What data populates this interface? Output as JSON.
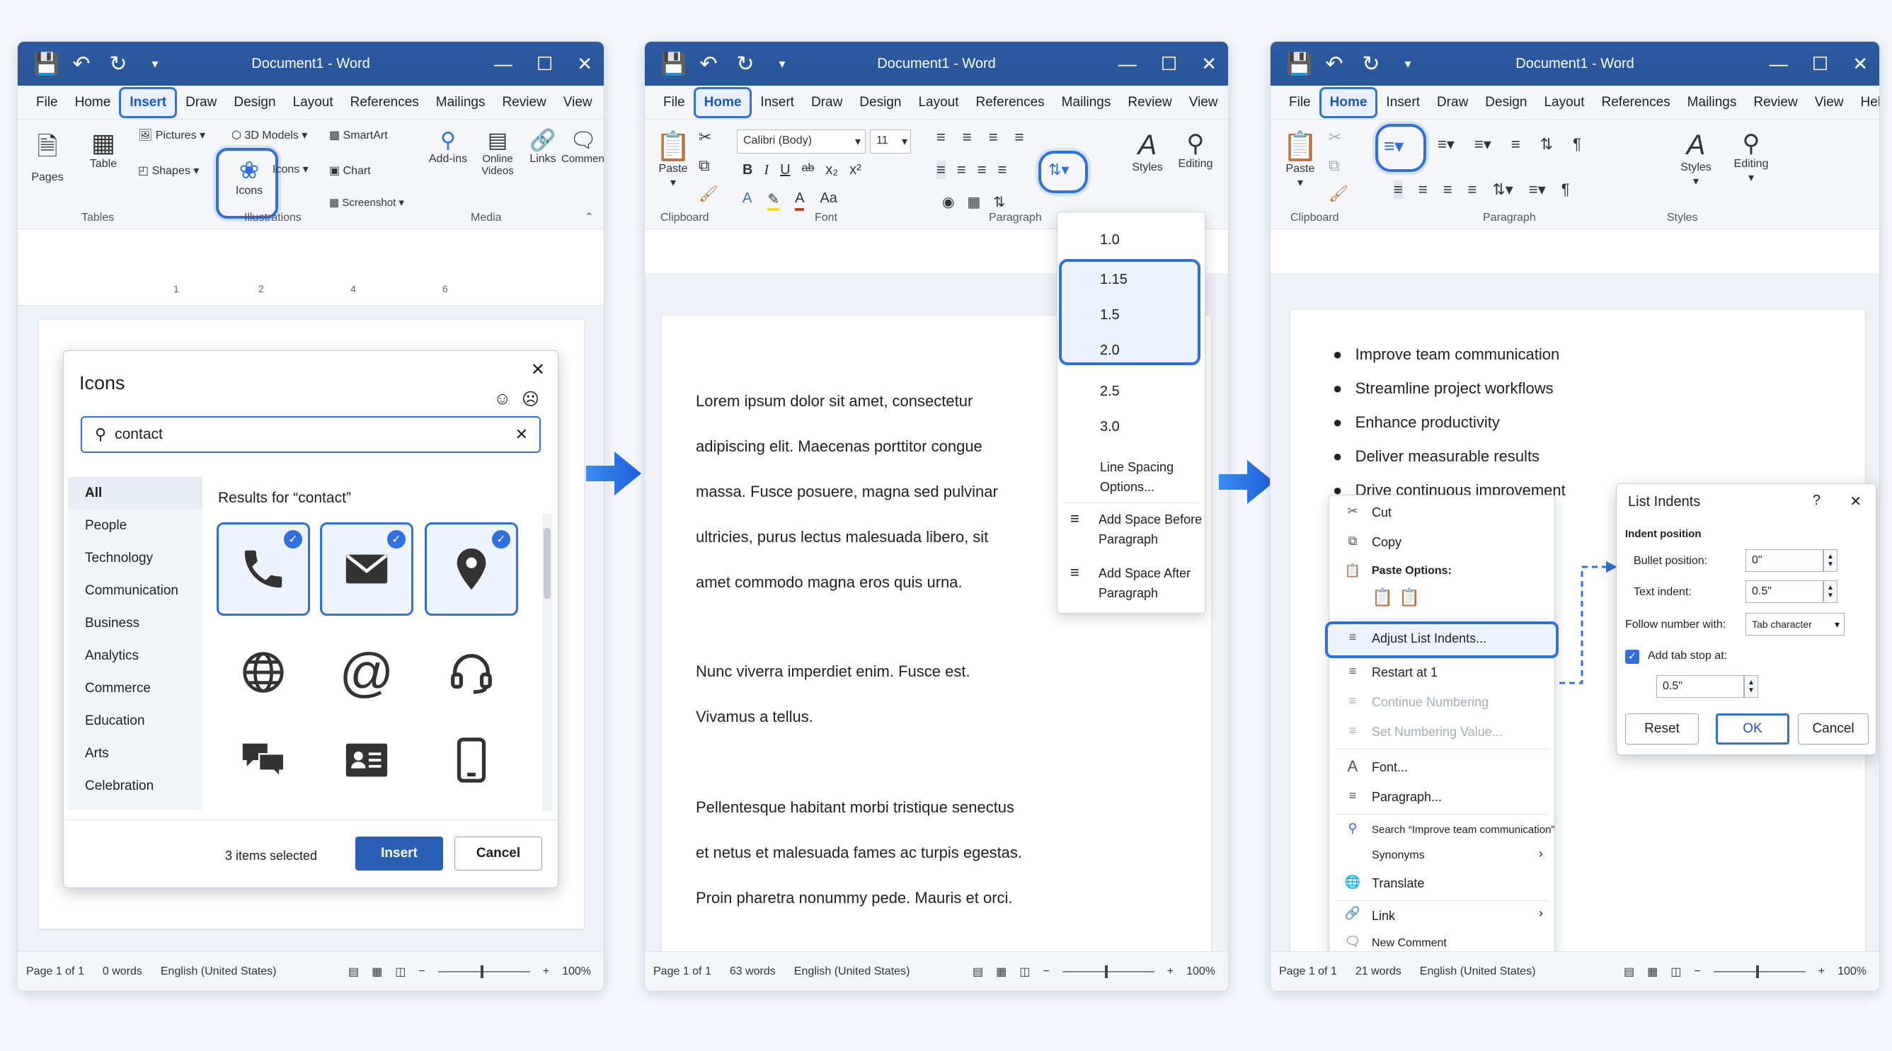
{
  "common": {
    "window_title": "Document1 - Word",
    "menu": [
      "File",
      "Home",
      "Insert",
      "Draw",
      "Design",
      "Layout",
      "References",
      "Mailings",
      "Review",
      "View",
      "Help"
    ],
    "status_language": "English (United States)",
    "status_page": "Page 1 of 1",
    "zoom": "100%"
  },
  "win1": {
    "active_tab": "Insert",
    "ribbon": {
      "pages": "Pages",
      "table": "Table",
      "pictures": "Pictures",
      "shapes": "Shapes",
      "models3d": "3D Models",
      "icons": "Icons",
      "smartart": "SmartArt",
      "chart": "Chart",
      "screenshot": "Screenshot",
      "addins": "Add-ins",
      "online_videos": "Online Videos",
      "links": "Links",
      "comment": "Comment",
      "grp_tables": "Tables",
      "grp_illustrations": "Illustrations",
      "grp_media": "Media"
    },
    "ruler_marks": [
      "1",
      "2",
      "4",
      "6"
    ],
    "dialog": {
      "title": "Icons",
      "search_value": "contact",
      "results_label": "Results for “contact”",
      "categories": [
        "All",
        "People",
        "Technology",
        "Communication",
        "Business",
        "Analytics",
        "Commerce",
        "Education",
        "Arts",
        "Celebration"
      ],
      "selected_count": "3 items selected",
      "insert_label": "Insert",
      "cancel_label": "Cancel"
    },
    "status_words": "0 words"
  },
  "win2": {
    "active_tab": "Home",
    "ribbon": {
      "paste": "Paste",
      "font_name": "Calibri (Body)",
      "font_size": "11",
      "styles": "Styles",
      "editing": "Editing",
      "grp_clipboard": "Clipboard",
      "grp_font": "Font",
      "grp_paragraph": "Paragraph"
    },
    "paragraphs": [
      [
        "Lorem ipsum dolor sit amet, consectetur",
        "adipiscing elit. Maecenas porttitor congue",
        "massa. Fusce posuere, magna sed pulvinar",
        "ultricies, purus lectus malesuada libero, sit",
        "amet commodo magna eros quis urna."
      ],
      [
        "Nunc viverra imperdiet enim. Fusce est.",
        "Vivamus a tellus."
      ],
      [
        "Pellentesque habitant morbi tristique senectus",
        "et netus et malesuada fames ac turpis egestas.",
        "Proin pharetra nonummy pede. Mauris et orci."
      ]
    ],
    "spacing_menu": {
      "options": [
        "1.0",
        "1.15",
        "1.5",
        "2.0",
        "2.5",
        "3.0"
      ],
      "line_spacing_options": "Line Spacing Options...",
      "add_before": "Add Space Before Paragraph",
      "add_after": "Add Space After Paragraph"
    },
    "status_words": "63 words"
  },
  "win3": {
    "active_tab": "Home",
    "ribbon": {
      "paste": "Paste",
      "styles": "Styles",
      "editing": "Editing",
      "grp_clipboard": "Clipboard",
      "grp_paragraph": "Paragraph",
      "grp_styles": "Styles"
    },
    "bullets": [
      "Improve team communication",
      "Streamline project workflows",
      "Enhance productivity",
      "Deliver measurable results",
      "Drive continuous improvement"
    ],
    "context_menu": {
      "cut": "Cut",
      "copy": "Copy",
      "paste_options": "Paste Options:",
      "adjust_list_indents": "Adjust List Indents...",
      "restart_at_1": "Restart at 1",
      "continue_numbering": "Continue Numbering",
      "set_numbering_value": "Set Numbering Value...",
      "font": "Font...",
      "paragraph": "Paragraph...",
      "search": "Search “Improve team communication”",
      "synonyms": "Synonyms",
      "translate": "Translate",
      "link": "Link",
      "new_comment": "New Comment"
    },
    "list_indents": {
      "title": "List Indents",
      "help": "?",
      "section": "Indent position",
      "bullet_position_label": "Bullet position:",
      "bullet_position_value": "0\"",
      "text_indent_label": "Text indent:",
      "text_indent_value": "0.5\"",
      "follow_label": "Follow number with:",
      "follow_value": "Tab character",
      "tab_stop_label": "Add tab stop at:",
      "tab_stop_checked": true,
      "tab_stop_value": "0.5\"",
      "reset": "Reset",
      "ok": "OK",
      "cancel": "Cancel"
    },
    "status_words": "21 words"
  },
  "colors": {
    "title_bar": "#2c5aa0",
    "accent": "#2f6fe0",
    "primary_button": "#2b5eb5"
  }
}
